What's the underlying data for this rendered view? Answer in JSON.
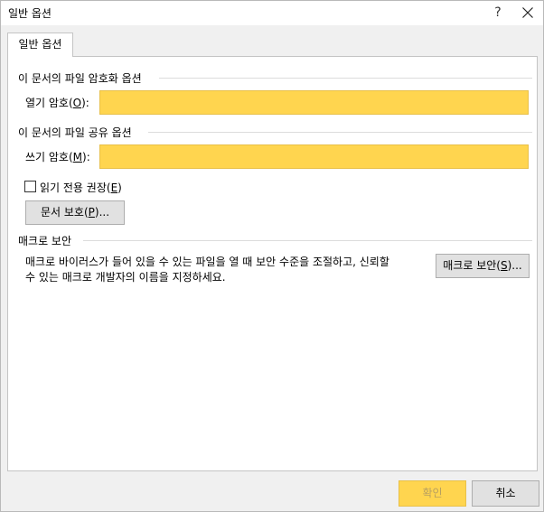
{
  "dialog": {
    "title": "일반 옵션",
    "help_label": "?"
  },
  "tab": {
    "label": "일반 옵션"
  },
  "encryption": {
    "heading": "이 문서의 파일 암호화 옵션",
    "open_password_label": "열기 암호(",
    "open_password_key": "O",
    "open_password_suffix": "):",
    "open_password_value": ""
  },
  "sharing": {
    "heading": "이 문서의 파일 공유 옵션",
    "write_password_label": "쓰기 암호(",
    "write_password_key": "M",
    "write_password_suffix": "):",
    "write_password_value": "",
    "readonly_label": "읽기 전용 권장(",
    "readonly_key": "E",
    "readonly_suffix": ")",
    "readonly_checked": false,
    "protect_label": "문서 보호(",
    "protect_key": "P",
    "protect_suffix": ")..."
  },
  "macro": {
    "heading": "매크로 보안",
    "description_line1": "매크로 바이러스가 들어 있을 수 있는 파일을 열 때 보안 수준을 조절하고, 신뢰할",
    "description_line2": "수 있는 매크로 개발자의 이름을 지정하세요.",
    "button_label": "매크로 보안(",
    "button_key": "S",
    "button_suffix": ")..."
  },
  "footer": {
    "ok_label": "확인",
    "cancel_label": "취소"
  },
  "colors": {
    "highlight": "#ffd54f",
    "dialog_bg": "#f0f0f0",
    "panel_bg": "#ffffff"
  }
}
